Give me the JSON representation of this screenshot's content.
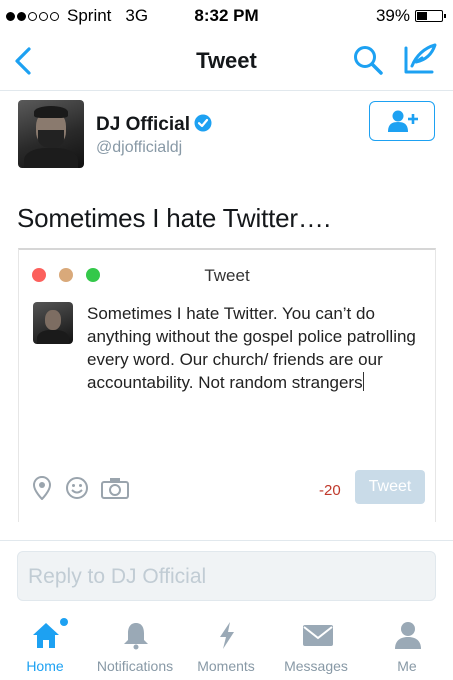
{
  "status_bar": {
    "carrier": "Sprint",
    "network": "3G",
    "time": "8:32 PM",
    "battery": "39%",
    "signal_bars_filled": 2,
    "signal_bars_total": 5
  },
  "nav": {
    "title": "Tweet",
    "back_icon": "chevron-left-icon",
    "search_icon": "search-icon",
    "compose_icon": "compose-icon"
  },
  "author": {
    "name": "DJ Official",
    "handle": "@djofficialdj",
    "verified": true,
    "follow_icon": "add-user-icon"
  },
  "tweet": {
    "text": "Sometimes I hate Twitter…."
  },
  "embedded_screenshot": {
    "window_title": "Tweet",
    "body": "Sometimes I hate Twitter. You can’t do anything without the gospel police patrolling every word. Our church/ friends are our accountability. Not random strangers",
    "char_count": "-20",
    "tweet_button": "Tweet",
    "traffic_light_colors": [
      "#fc605c",
      "#d9a97a",
      "#34c84a"
    ]
  },
  "reply": {
    "placeholder": "Reply to DJ Official"
  },
  "tabs": [
    {
      "label": "Home",
      "icon": "home-icon",
      "active": true
    },
    {
      "label": "Notifications",
      "icon": "bell-icon",
      "active": false
    },
    {
      "label": "Moments",
      "icon": "lightning-icon",
      "active": false
    },
    {
      "label": "Messages",
      "icon": "envelope-icon",
      "active": false
    },
    {
      "label": "Me",
      "icon": "person-icon",
      "active": false
    }
  ],
  "colors": {
    "accent": "#1da1f2",
    "inactive": "#8899a6"
  }
}
